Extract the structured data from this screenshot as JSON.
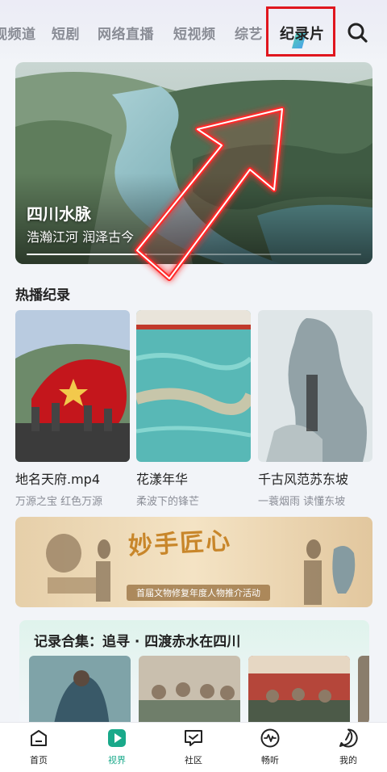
{
  "top_tabs": [
    {
      "label": "视频道"
    },
    {
      "label": "短剧"
    },
    {
      "label": "网络直播"
    },
    {
      "label": "短视频"
    },
    {
      "label": "综艺"
    },
    {
      "label": "纪录片",
      "active": true
    }
  ],
  "search": {
    "icon": "search-icon"
  },
  "hero": {
    "title": "四川水脉",
    "subtitle": "浩瀚江河 润泽古今",
    "progress": 0.36
  },
  "hot_section": {
    "title": "热播纪录",
    "cards": [
      {
        "title": "地名天府.mp4",
        "subtitle": "万源之宝  红色万源"
      },
      {
        "title": "花漾年华",
        "subtitle": "柔波下的锋芒"
      },
      {
        "title": "千古风范苏东坡",
        "subtitle": "一蓑烟雨 读懂东坡"
      }
    ]
  },
  "promo": {
    "title": "妙手匠心",
    "subtitle": "首届文物修复年度人物推介活动"
  },
  "collection": {
    "title": "记录合集：追寻 · 四渡赤水在四川"
  },
  "bottom_nav": [
    {
      "label": "首页",
      "icon": "home-icon"
    },
    {
      "label": "视界",
      "icon": "play-icon",
      "active": true
    },
    {
      "label": "社区",
      "icon": "community-icon"
    },
    {
      "label": "畅听",
      "icon": "audio-icon"
    },
    {
      "label": "我的",
      "icon": "profile-icon"
    }
  ],
  "colors": {
    "accent": "#19a98a",
    "highlight_box": "#e0161e",
    "arrow": "#ff2a2a"
  }
}
